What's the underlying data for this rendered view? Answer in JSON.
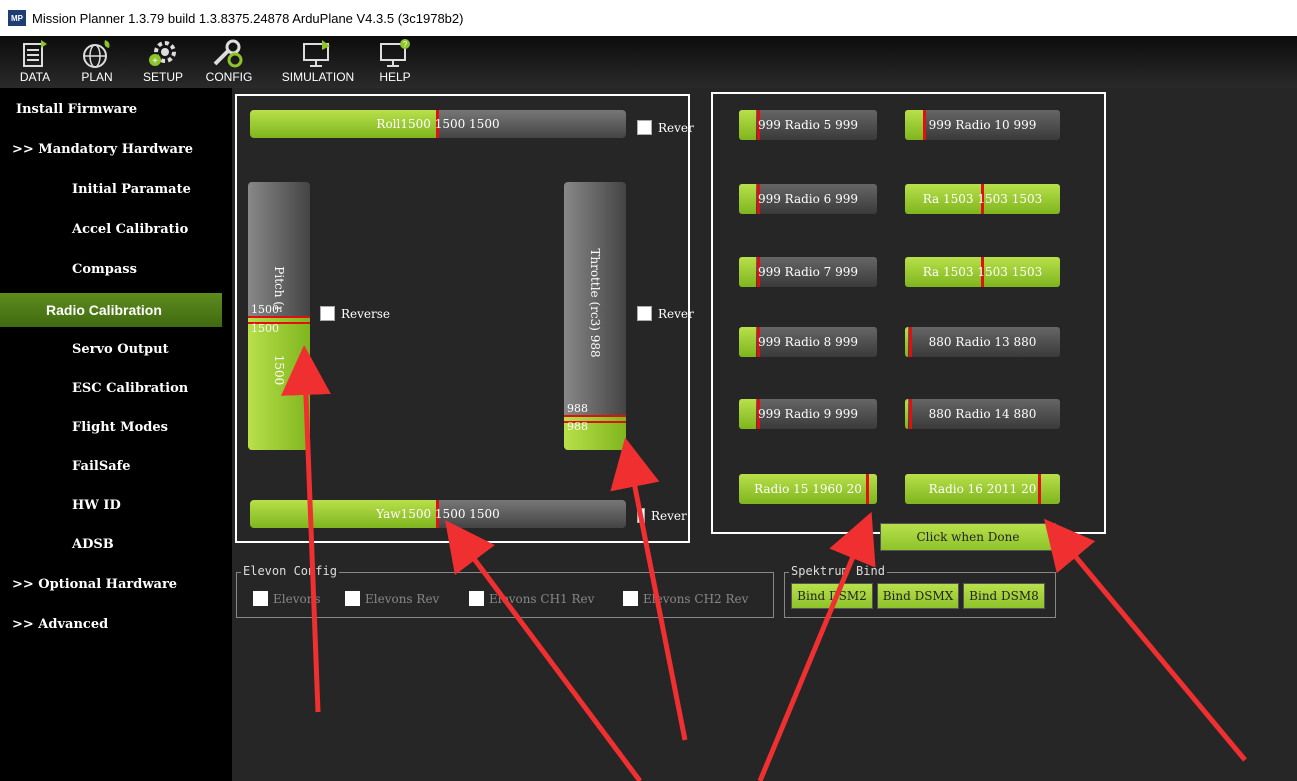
{
  "window": {
    "title": "Mission Planner 1.3.79 build 1.3.8375.24878 ArduPlane V4.3.5 (3c1978b2)",
    "logo_text": "MP"
  },
  "toolbar": {
    "items": [
      {
        "label": "DATA",
        "icon": "data-icon"
      },
      {
        "label": "PLAN",
        "icon": "plan-globe-icon"
      },
      {
        "label": "SETUP",
        "icon": "setup-gear-icon"
      },
      {
        "label": "CONFIG",
        "icon": "config-wrench-icon"
      },
      {
        "label": "SIMULATION",
        "icon": "simulation-monitor-icon"
      },
      {
        "label": "HELP",
        "icon": "help-monitor-icon"
      }
    ]
  },
  "nav": {
    "install_firmware": "Install Firmware",
    "mandatory_hardware": ">> Mandatory Hardware",
    "initial_parameters": "Initial Paramate",
    "accel_calibration": "Accel Calibratio",
    "compass": "Compass",
    "radio_calibration": "Radio Calibration",
    "servo_output": "Servo Output",
    "esc_calibration": "ESC Calibration",
    "flight_modes": "Flight Modes",
    "failsafe": "FailSafe",
    "hw_id": "HW ID",
    "adsb": "ADSB",
    "optional_hardware": ">> Optional Hardware",
    "advanced": ">> Advanced"
  },
  "radio": {
    "roll": {
      "text": "Roll1500 1500 1500",
      "value": 1500,
      "min": 1000,
      "max": 2000
    },
    "pitch": {
      "label": "Pitch (r",
      "value": 1500,
      "value_text": "1500",
      "min_text": "1500",
      "max_text": "1500",
      "fill": 0.5
    },
    "throttle": {
      "label": "Throttle (rc3)  988",
      "value_text": "988",
      "min_text": "988",
      "max_text": "988",
      "fill": 0.13
    },
    "yaw": {
      "text": "Yaw1500 1500 1500",
      "value": 1500
    },
    "reverse_label": "Reverse",
    "reverse_trunc": "Reve",
    "reverse_trunc2": "Rever"
  },
  "channels": {
    "r5": {
      "text": "999 Radio 5  999",
      "fill": 0.12
    },
    "r6": {
      "text": "999 Radio 6  999",
      "fill": 0.12
    },
    "r7": {
      "text": "999 Radio 7  999",
      "fill": 0.12
    },
    "r8": {
      "text": "999 Radio 8  999",
      "fill": 0.12
    },
    "r9": {
      "text": "999 Radio 9  999",
      "fill": 0.12
    },
    "r10": {
      "text": "999 Radio 10  999",
      "fill": 0.12
    },
    "r11": {
      "text": "Ra 1503 1503 1503",
      "fill": 1.0
    },
    "r12": {
      "text": "Ra 1503 1503 1503",
      "fill": 1.0
    },
    "r13": {
      "text": "880 Radio 13  880",
      "fill": 0.02
    },
    "r14": {
      "text": "880 Radio 14  880",
      "fill": 0.02
    },
    "r15": {
      "text": "Radio 15 1960  20",
      "fill": 1.0
    },
    "r16": {
      "text": "Radio 16  2011 20",
      "fill": 1.0
    }
  },
  "click_when_done": "Click when Done",
  "elevon": {
    "title": "Elevon Config",
    "elevons": "Elevons",
    "elevons_rev": "Elevons Rev",
    "elevons_ch1_rev": "Elevons CH1 Rev",
    "elevons_ch2_rev": "Elevons CH2 Rev"
  },
  "spektrum": {
    "title": "Spektrum Bind",
    "dsm2": "Bind DSM2",
    "dsmx": "Bind DSMX",
    "dsm8": "Bind DSM8"
  },
  "colors": {
    "accent_green": "#8ec32b",
    "marker_red": "#e01010",
    "annotation_arrow": "#f03030"
  }
}
